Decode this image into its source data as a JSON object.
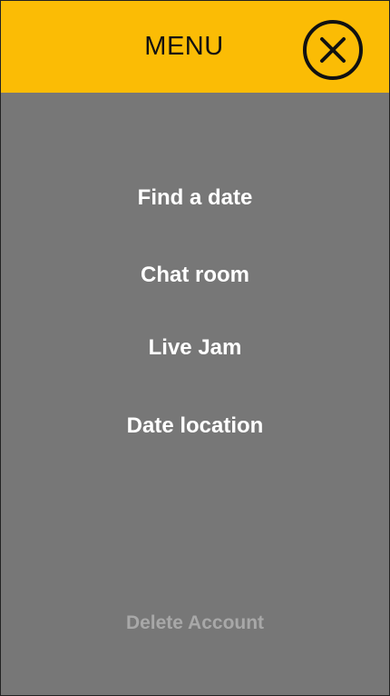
{
  "header": {
    "title": "MENU",
    "close_icon": "close-circle-icon"
  },
  "menu": {
    "items": [
      {
        "label": "Find a date"
      },
      {
        "label": "Chat room"
      },
      {
        "label": "Live Jam"
      },
      {
        "label": "Date location"
      }
    ],
    "delete_account": "Delete Account"
  },
  "colors": {
    "header_background": "#fbbc05",
    "menu_background": "#777777",
    "menu_text": "#ffffff",
    "muted_text": "#a8a8a8"
  }
}
